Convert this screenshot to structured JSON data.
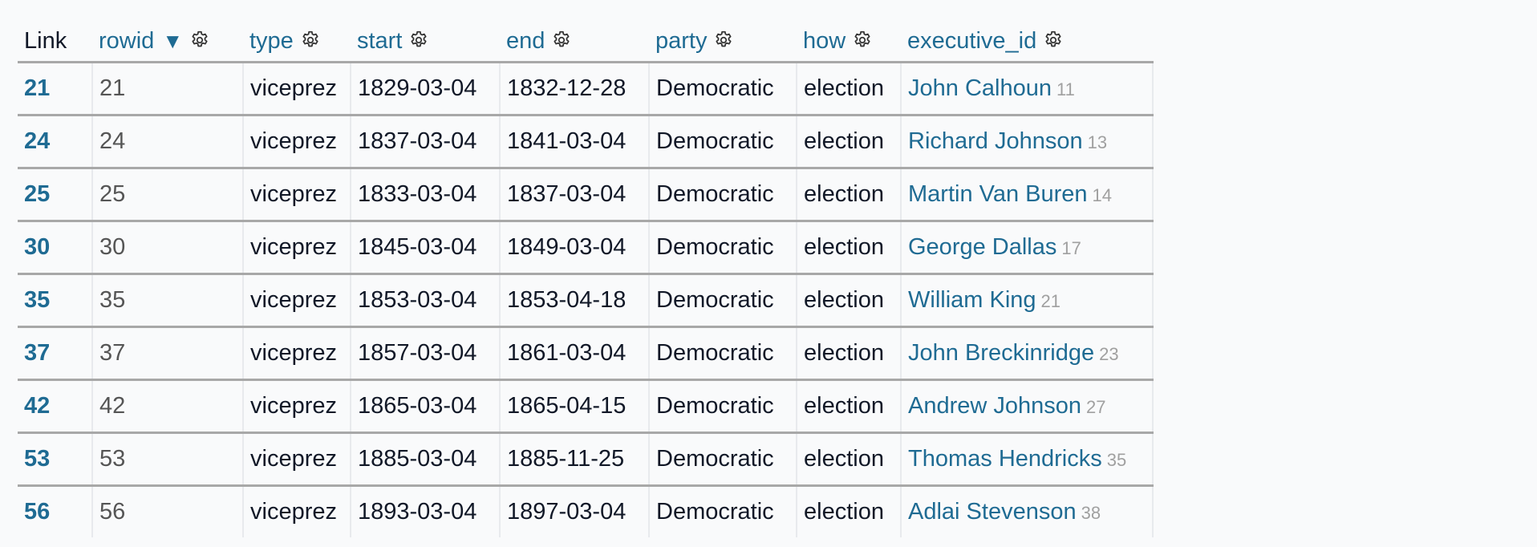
{
  "table": {
    "columns": [
      {
        "key": "link",
        "label": "Link",
        "sortable": false
      },
      {
        "key": "rowid",
        "label": "rowid",
        "sort_indicator": "▼"
      },
      {
        "key": "type",
        "label": "type"
      },
      {
        "key": "start",
        "label": "start"
      },
      {
        "key": "end",
        "label": "end"
      },
      {
        "key": "party",
        "label": "party"
      },
      {
        "key": "how",
        "label": "how"
      },
      {
        "key": "executive_id",
        "label": "executive_id"
      }
    ],
    "rows": [
      {
        "link": "21",
        "rowid": "21",
        "type": "viceprez",
        "start": "1829-03-04",
        "end": "1832-12-28",
        "party": "Democratic",
        "how": "election",
        "executive_name": "John Calhoun",
        "executive_id": "11"
      },
      {
        "link": "24",
        "rowid": "24",
        "type": "viceprez",
        "start": "1837-03-04",
        "end": "1841-03-04",
        "party": "Democratic",
        "how": "election",
        "executive_name": "Richard Johnson",
        "executive_id": "13"
      },
      {
        "link": "25",
        "rowid": "25",
        "type": "viceprez",
        "start": "1833-03-04",
        "end": "1837-03-04",
        "party": "Democratic",
        "how": "election",
        "executive_name": "Martin Van Buren",
        "executive_id": "14"
      },
      {
        "link": "30",
        "rowid": "30",
        "type": "viceprez",
        "start": "1845-03-04",
        "end": "1849-03-04",
        "party": "Democratic",
        "how": "election",
        "executive_name": "George Dallas",
        "executive_id": "17"
      },
      {
        "link": "35",
        "rowid": "35",
        "type": "viceprez",
        "start": "1853-03-04",
        "end": "1853-04-18",
        "party": "Democratic",
        "how": "election",
        "executive_name": "William King",
        "executive_id": "21"
      },
      {
        "link": "37",
        "rowid": "37",
        "type": "viceprez",
        "start": "1857-03-04",
        "end": "1861-03-04",
        "party": "Democratic",
        "how": "election",
        "executive_name": "John Breckinridge",
        "executive_id": "23"
      },
      {
        "link": "42",
        "rowid": "42",
        "type": "viceprez",
        "start": "1865-03-04",
        "end": "1865-04-15",
        "party": "Democratic",
        "how": "election",
        "executive_name": "Andrew Johnson",
        "executive_id": "27"
      },
      {
        "link": "53",
        "rowid": "53",
        "type": "viceprez",
        "start": "1885-03-04",
        "end": "1885-11-25",
        "party": "Democratic",
        "how": "election",
        "executive_name": "Thomas Hendricks",
        "executive_id": "35"
      },
      {
        "link": "56",
        "rowid": "56",
        "type": "viceprez",
        "start": "1893-03-04",
        "end": "1897-03-04",
        "party": "Democratic",
        "how": "election",
        "executive_name": "Adlai Stevenson",
        "executive_id": "38"
      }
    ]
  },
  "icons": {
    "column_menu": "gear-icon",
    "sort": "sort-descending-icon"
  },
  "colors": {
    "link": "#1f6b93",
    "text": "#111827",
    "muted": "#a0a0a0",
    "background": "#f9fafb",
    "row_border": "#a8a8a8"
  }
}
